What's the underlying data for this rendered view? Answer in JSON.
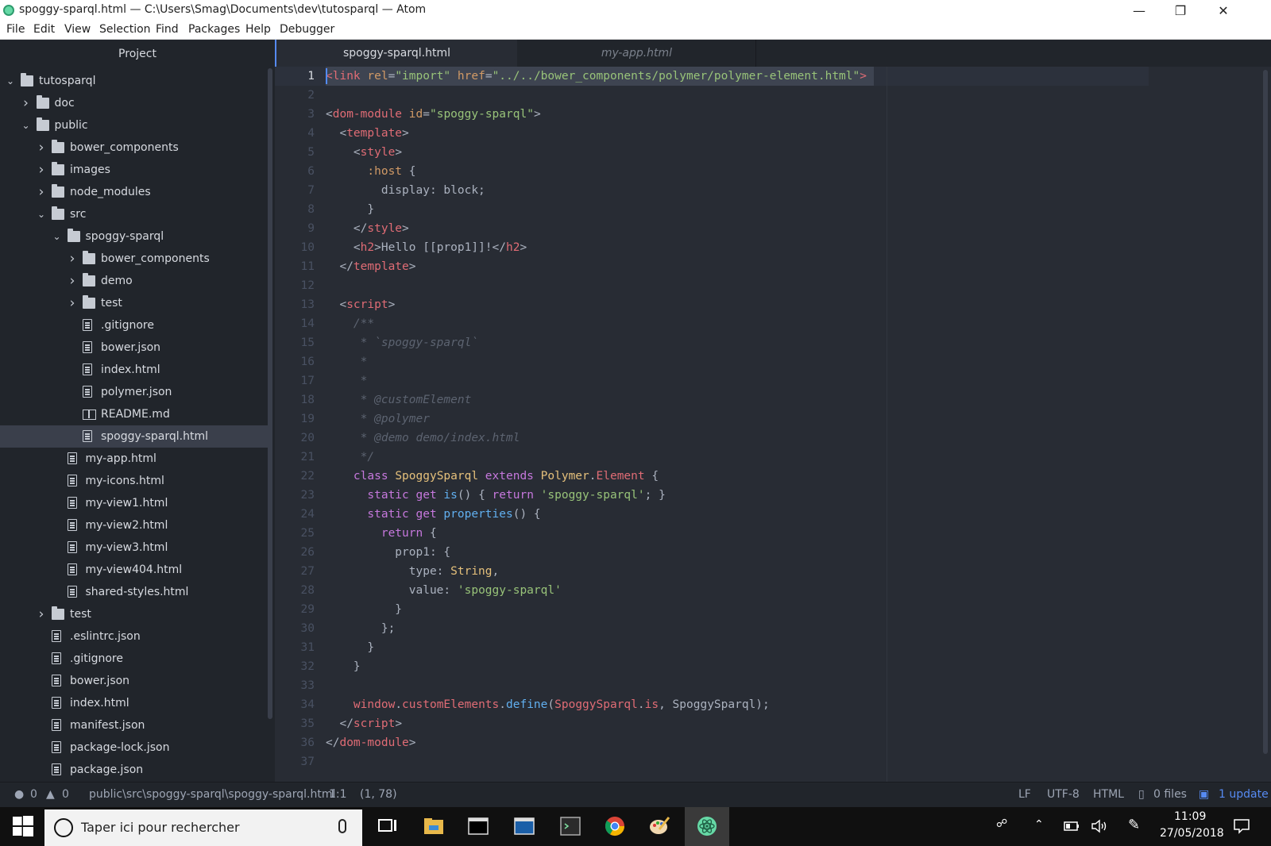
{
  "window": {
    "title": "spoggy-sparql.html — C:\\Users\\Smag\\Documents\\dev\\tutosparql — Atom",
    "minimize": "—",
    "restore": "❐",
    "close": "✕"
  },
  "menu": [
    "File",
    "Edit",
    "View",
    "Selection",
    "Find",
    "Packages",
    "Help",
    "Debugger"
  ],
  "tree": {
    "header": "Project",
    "items": [
      {
        "label": "tutosparql",
        "kind": "folder",
        "open": true,
        "depth": 0
      },
      {
        "label": "doc",
        "kind": "folder",
        "open": false,
        "depth": 1
      },
      {
        "label": "public",
        "kind": "folder",
        "open": true,
        "depth": 1
      },
      {
        "label": "bower_components",
        "kind": "folder",
        "open": false,
        "depth": 2
      },
      {
        "label": "images",
        "kind": "folder",
        "open": false,
        "depth": 2
      },
      {
        "label": "node_modules",
        "kind": "folder",
        "open": false,
        "depth": 2
      },
      {
        "label": "src",
        "kind": "folder",
        "open": true,
        "depth": 2
      },
      {
        "label": "spoggy-sparql",
        "kind": "folder",
        "open": true,
        "depth": 3
      },
      {
        "label": "bower_components",
        "kind": "folder",
        "open": false,
        "depth": 4
      },
      {
        "label": "demo",
        "kind": "folder",
        "open": false,
        "depth": 4
      },
      {
        "label": "test",
        "kind": "folder",
        "open": false,
        "depth": 4
      },
      {
        "label": ".gitignore",
        "kind": "file",
        "depth": 4
      },
      {
        "label": "bower.json",
        "kind": "file",
        "depth": 4
      },
      {
        "label": "index.html",
        "kind": "file",
        "depth": 4
      },
      {
        "label": "polymer.json",
        "kind": "file",
        "depth": 4
      },
      {
        "label": "README.md",
        "kind": "book",
        "depth": 4
      },
      {
        "label": "spoggy-sparql.html",
        "kind": "file",
        "depth": 4,
        "selected": true
      },
      {
        "label": "my-app.html",
        "kind": "file",
        "depth": 3
      },
      {
        "label": "my-icons.html",
        "kind": "file",
        "depth": 3
      },
      {
        "label": "my-view1.html",
        "kind": "file",
        "depth": 3
      },
      {
        "label": "my-view2.html",
        "kind": "file",
        "depth": 3
      },
      {
        "label": "my-view3.html",
        "kind": "file",
        "depth": 3
      },
      {
        "label": "my-view404.html",
        "kind": "file",
        "depth": 3
      },
      {
        "label": "shared-styles.html",
        "kind": "file",
        "depth": 3
      },
      {
        "label": "test",
        "kind": "folder",
        "open": false,
        "depth": 2
      },
      {
        "label": ".eslintrc.json",
        "kind": "file",
        "depth": 2
      },
      {
        "label": ".gitignore",
        "kind": "file",
        "depth": 2
      },
      {
        "label": "bower.json",
        "kind": "file",
        "depth": 2
      },
      {
        "label": "index.html",
        "kind": "file",
        "depth": 2
      },
      {
        "label": "manifest.json",
        "kind": "file",
        "depth": 2
      },
      {
        "label": "package-lock.json",
        "kind": "file",
        "depth": 2
      },
      {
        "label": "package.json",
        "kind": "file",
        "depth": 2
      }
    ]
  },
  "tabs": [
    {
      "label": "spoggy-sparql.html",
      "active": true
    },
    {
      "label": "my-app.html",
      "active": false
    }
  ],
  "editor": {
    "current_line": 1,
    "lines": [
      [
        [
          "t",
          "<link "
        ],
        [
          "a",
          "rel"
        ],
        [
          "p",
          "="
        ],
        [
          "s",
          "\"import\""
        ],
        [
          "a",
          " href"
        ],
        [
          "p",
          "="
        ],
        [
          "s",
          "\"../../bower_components/polymer/polymer-element.html\""
        ],
        [
          "t",
          ">"
        ]
      ],
      [],
      [
        [
          "p",
          "<"
        ],
        [
          "t",
          "dom-module"
        ],
        [
          "a",
          " id"
        ],
        [
          "p",
          "="
        ],
        [
          "s",
          "\"spoggy-sparql\""
        ],
        [
          "p",
          ">"
        ]
      ],
      [
        [
          "p",
          "  <"
        ],
        [
          "t",
          "template"
        ],
        [
          "p",
          ">"
        ]
      ],
      [
        [
          "p",
          "    <"
        ],
        [
          "t",
          "style"
        ],
        [
          "p",
          ">"
        ]
      ],
      [
        [
          "a",
          "      :host"
        ],
        [
          "p",
          " {"
        ]
      ],
      [
        [
          "p",
          "        display: block;"
        ]
      ],
      [
        [
          "p",
          "      }"
        ]
      ],
      [
        [
          "p",
          "    </"
        ],
        [
          "t",
          "style"
        ],
        [
          "p",
          ">"
        ]
      ],
      [
        [
          "p",
          "    <"
        ],
        [
          "t",
          "h2"
        ],
        [
          "p",
          ">Hello [[prop1]]!</"
        ],
        [
          "t",
          "h2"
        ],
        [
          "p",
          ">"
        ]
      ],
      [
        [
          "p",
          "  </"
        ],
        [
          "t",
          "template"
        ],
        [
          "p",
          ">"
        ]
      ],
      [],
      [
        [
          "p",
          "  <"
        ],
        [
          "t",
          "script"
        ],
        [
          "p",
          ">"
        ]
      ],
      [
        [
          "c",
          "    /**"
        ]
      ],
      [
        [
          "c",
          "     * `spoggy-sparql`"
        ]
      ],
      [
        [
          "c",
          "     *"
        ]
      ],
      [
        [
          "c",
          "     *"
        ]
      ],
      [
        [
          "c",
          "     * @customElement"
        ]
      ],
      [
        [
          "c",
          "     * @polymer"
        ]
      ],
      [
        [
          "c",
          "     * @demo demo/index.html"
        ]
      ],
      [
        [
          "c",
          "     */"
        ]
      ],
      [
        [
          "k",
          "    class "
        ],
        [
          "cl",
          "SpoggySparql"
        ],
        [
          "k",
          " extends "
        ],
        [
          "cl",
          "Polymer"
        ],
        [
          "p",
          "."
        ],
        [
          "t",
          "Element"
        ],
        [
          "p",
          " {"
        ]
      ],
      [
        [
          "k",
          "      static "
        ],
        [
          "k",
          "get "
        ],
        [
          "f",
          "is"
        ],
        [
          "p",
          "() { "
        ],
        [
          "k",
          "return "
        ],
        [
          "s",
          "'spoggy-sparql'"
        ],
        [
          "p",
          "; }"
        ]
      ],
      [
        [
          "k",
          "      static "
        ],
        [
          "k",
          "get "
        ],
        [
          "f",
          "properties"
        ],
        [
          "p",
          "() {"
        ]
      ],
      [
        [
          "k",
          "        return"
        ],
        [
          "p",
          " {"
        ]
      ],
      [
        [
          "p",
          "          prop1: {"
        ]
      ],
      [
        [
          "p",
          "            type: "
        ],
        [
          "cl",
          "String"
        ],
        [
          "p",
          ","
        ]
      ],
      [
        [
          "p",
          "            value: "
        ],
        [
          "s",
          "'spoggy-sparql'"
        ]
      ],
      [
        [
          "p",
          "          }"
        ]
      ],
      [
        [
          "p",
          "        };"
        ]
      ],
      [
        [
          "p",
          "      }"
        ]
      ],
      [
        [
          "p",
          "    }"
        ]
      ],
      [],
      [
        [
          "w",
          "    window"
        ],
        [
          "p",
          "."
        ],
        [
          "t",
          "customElements"
        ],
        [
          "p",
          "."
        ],
        [
          "f",
          "define"
        ],
        [
          "p",
          "("
        ],
        [
          "w",
          "SpoggySparql"
        ],
        [
          "p",
          "."
        ],
        [
          "t",
          "is"
        ],
        [
          "p",
          ", SpoggySparql);"
        ]
      ],
      [
        [
          "p",
          "  </"
        ],
        [
          "t",
          "script"
        ],
        [
          "p",
          ">"
        ]
      ],
      [
        [
          "p",
          "</"
        ],
        [
          "t",
          "dom-module"
        ],
        [
          "p",
          ">"
        ]
      ],
      []
    ]
  },
  "status": {
    "errors": "0",
    "warnings": "0",
    "path": "public\\src\\spoggy-sparql\\spoggy-sparql.html",
    "cursor": "1:1",
    "selection": "(1, 78)",
    "line_ending": "LF",
    "encoding": "UTF-8",
    "grammar": "HTML",
    "git_files": "0 files",
    "updates": "1 update"
  },
  "taskbar": {
    "search_placeholder": "Taper ici pour rechercher",
    "time": "11:09",
    "date": "27/05/2018"
  }
}
